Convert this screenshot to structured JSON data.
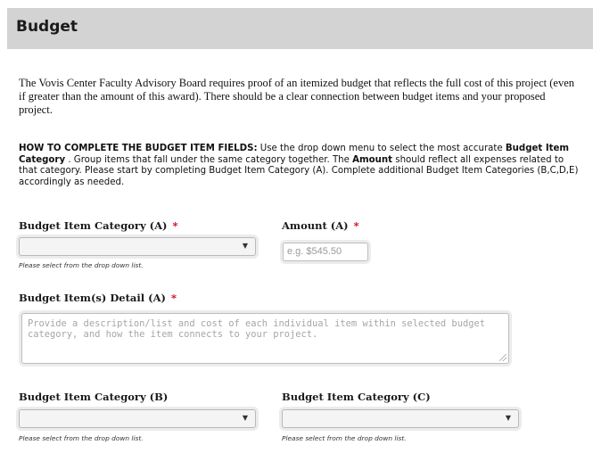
{
  "header": {
    "title": "Budget"
  },
  "intro": "The Vovis Center Faculty Advisory Board requires proof of an itemized budget that reflects the full cost of this project (even if greater than the amount of this award). There should be a clear connection between budget items and your proposed project.",
  "howto": {
    "heading": "HOW TO COMPLETE THE BUDGET ITEM FIELDS:",
    "text_1": " Use the drop down menu to select the most accurate ",
    "bold_1": "Budget Item Category",
    "text_2": " . Group items that fall under the same category together. The ",
    "bold_2": "Amount",
    "text_3": " should reflect all expenses related to that category. Please start by completing Budget Item Category (A). Complete additional Budget Item Categories (B,C,D,E) accordingly as needed."
  },
  "fields": {
    "category_a": {
      "label": "Budget Item Category (A)",
      "required": "*",
      "hint": "Please select from the drop down list.",
      "value": ""
    },
    "amount_a": {
      "label": "Amount (A)",
      "required": "*",
      "placeholder": "e.g. $545.50"
    },
    "detail_a": {
      "label": "Budget Item(s) Detail (A)",
      "required": "*",
      "placeholder": "Provide a description/list and cost of each individual item within selected budget category, and how the item connects to your project."
    },
    "category_b": {
      "label": "Budget Item Category (B)",
      "hint": "Please select from the drop down list.",
      "value": ""
    },
    "category_c": {
      "label": "Budget Item Category (C)",
      "hint": "Please select from the drop down list.",
      "value": ""
    }
  },
  "icons": {
    "dropdown_arrow": "▼"
  },
  "colors": {
    "header_bg": "#d3d3d3",
    "required": "#d0021b"
  }
}
